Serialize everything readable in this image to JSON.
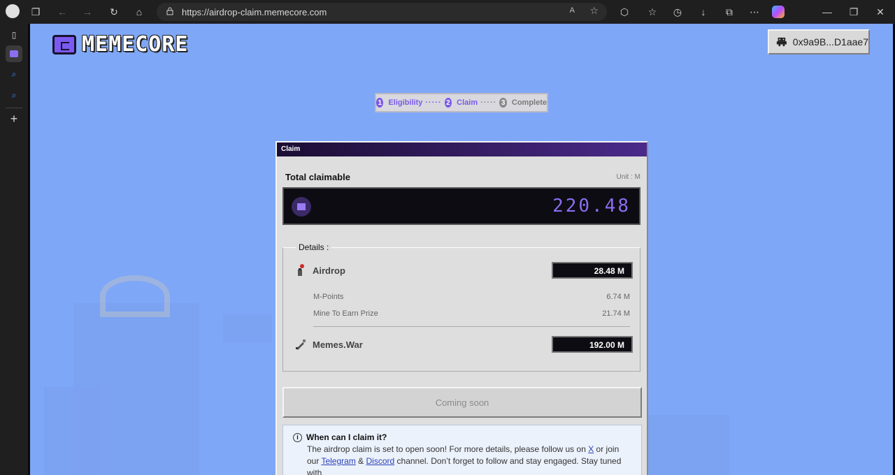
{
  "browser": {
    "url": "https://airdrop-claim.memecore.com"
  },
  "page": {
    "logo_text": "MEMECORE",
    "wallet": "0x9a9B...D1aae7"
  },
  "stepper": {
    "steps": [
      {
        "num": "1",
        "label": "Eligibility"
      },
      {
        "num": "2",
        "label": "Claim"
      },
      {
        "num": "3",
        "label": "Complete"
      }
    ],
    "dots": "·····"
  },
  "claim_window": {
    "title": "Claim",
    "total_label": "Total claimable",
    "unit": "Unit : M",
    "total_value": "220.48",
    "details_legend": "Details :",
    "airdrop": {
      "label": "Airdrop",
      "value": "28.48  M"
    },
    "sub_items": [
      {
        "label": "M-Points",
        "value": "6.74 M"
      },
      {
        "label": "Mine To Earn Prize",
        "value": "21.74 M"
      }
    ],
    "memes_war": {
      "label": "Memes.War",
      "value": "192.00  M"
    },
    "button": "Coming soon",
    "info": {
      "title": "When can I claim it?",
      "text_1": "The airdrop claim is set to open soon! For more details, please follow us on ",
      "link_x": "X",
      "text_2": " or join our ",
      "link_telegram": "Telegram",
      "text_3": " & ",
      "link_discord": "Discord",
      "text_4": " channel. Don’t forget to follow and stay engaged. Stay tuned with"
    }
  },
  "colors": {
    "background": "#7fa7f7",
    "accent": "#7b5ae6"
  }
}
